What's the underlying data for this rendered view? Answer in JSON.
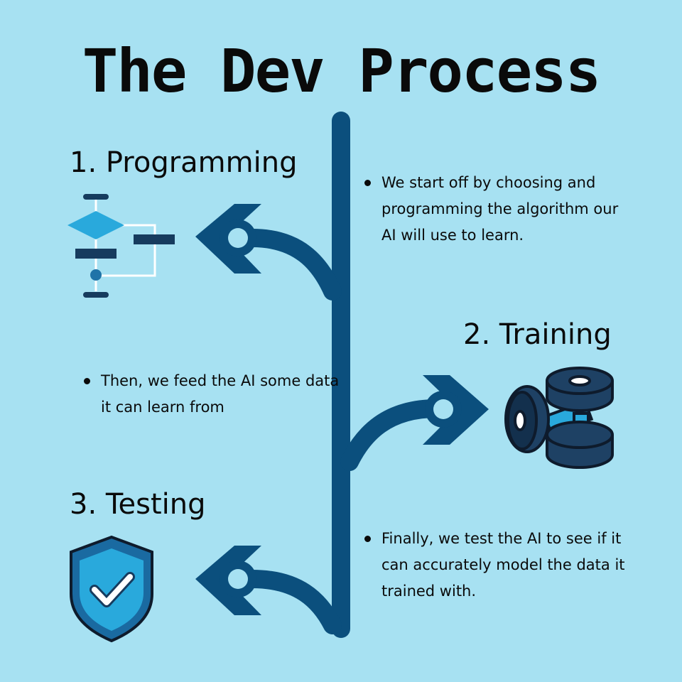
{
  "title": "The Dev Process",
  "steps": [
    {
      "heading": "1. Programming",
      "description": "We start off by choosing and programming the algorithm our AI will use to learn.",
      "icon": "flowchart-icon"
    },
    {
      "heading": "2. Training",
      "description": "Then, we feed the AI some data it can learn from",
      "icon": "dumbbell-icon"
    },
    {
      "heading": "3. Testing",
      "description": "Finally, we test the AI to see if it can accurately model the data it trained with.",
      "icon": "shield-check-icon"
    }
  ],
  "colors": {
    "background": "#a7e1f2",
    "dark_blue": "#0b4f7d",
    "navy": "#163b5e",
    "accent": "#29a9dc",
    "text": "#0a0a0a"
  }
}
